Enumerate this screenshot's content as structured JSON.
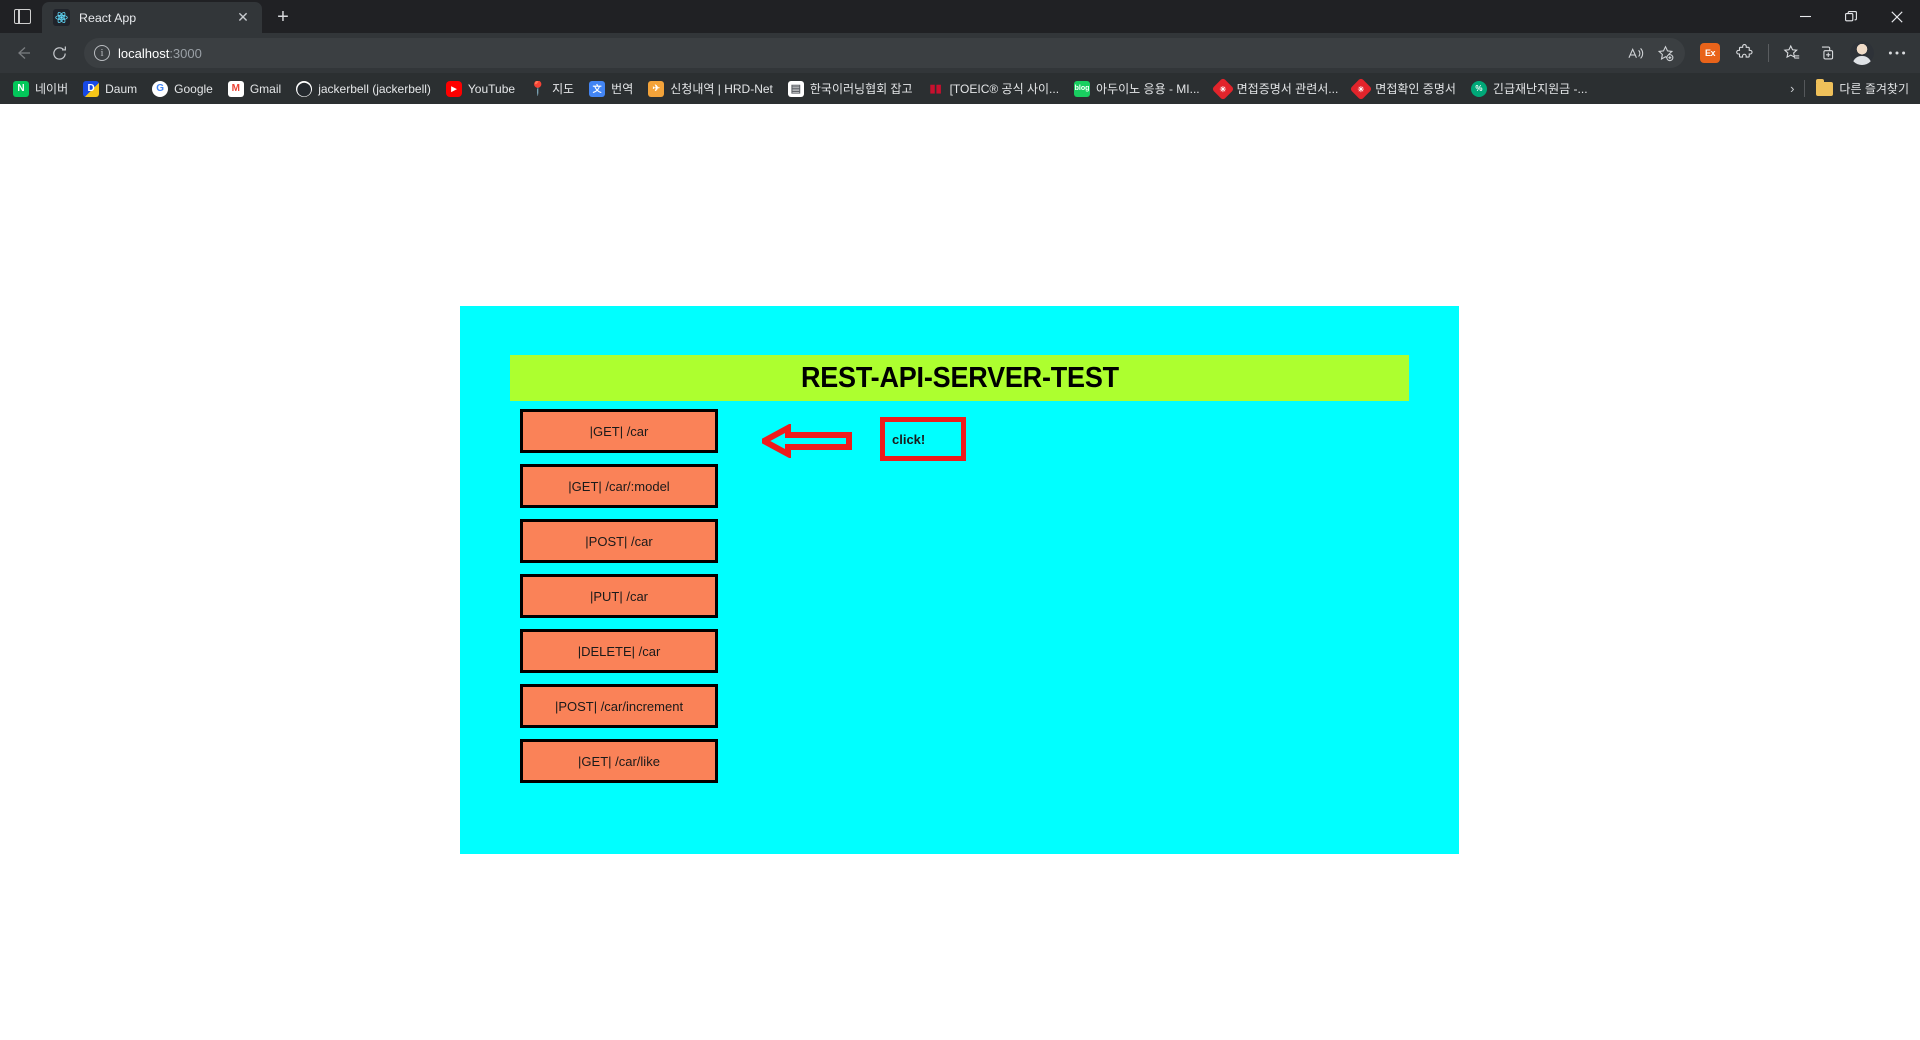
{
  "window": {
    "controls": [
      {
        "name": "minimize",
        "glyph": "—"
      },
      {
        "name": "restore",
        "glyph": "❐"
      },
      {
        "name": "close",
        "glyph": "✕"
      }
    ]
  },
  "tabstrip": {
    "tab_search_icon": "panel-icon",
    "tabs": [
      {
        "title": "React App",
        "favicon": "react-icon",
        "close_glyph": "✕"
      }
    ],
    "new_tab_glyph": "+"
  },
  "navbar": {
    "back_glyph": "←",
    "refresh_glyph": "⟳",
    "url_prefix": "localhost",
    "url_suffix": ":3000",
    "info_icon_glyph": "i",
    "read_aloud_glyph": "A",
    "add_favorite_glyph": "☆",
    "extension_badge_label": "Ex",
    "extensions_glyph": "puzzle",
    "collections_glyph": "star-list",
    "split_screen_glyph": "tab-plus",
    "settings_glyph": "…"
  },
  "bookmarks": {
    "items": [
      {
        "label": "네이버",
        "icon": "naver-icon",
        "color": "#03c75a",
        "text": "N"
      },
      {
        "label": "Daum",
        "icon": "daum-icon",
        "color": "#1749e6",
        "text": "D"
      },
      {
        "label": "Google",
        "icon": "google-icon",
        "color": "#ffffff",
        "text": "G"
      },
      {
        "label": "Gmail",
        "icon": "gmail-icon",
        "color": "#ffffff",
        "text": "M"
      },
      {
        "label": "jackerbell (jackerbell)",
        "icon": "github-icon",
        "color": "#ffffff",
        "text": "●"
      },
      {
        "label": "YouTube",
        "icon": "youtube-icon",
        "color": "#ff0000",
        "text": "▶"
      },
      {
        "label": "지도",
        "icon": "maps-icon",
        "color": "#34a853",
        "text": "◆"
      },
      {
        "label": "번역",
        "icon": "translate-icon",
        "color": "#4285f4",
        "text": "文"
      },
      {
        "label": "신청내역 | HRD-Net",
        "icon": "hrdnet-icon",
        "color": "#f3a33a",
        "text": "✈"
      },
      {
        "label": "한국이러닝협회 잡고",
        "icon": "document-icon",
        "color": "#ffffff",
        "text": "▤"
      },
      {
        "label": "[TOEIC® 공식 사이...",
        "icon": "toeic-icon",
        "color": "#c8102e",
        "text": "▮"
      },
      {
        "label": "아두이노 응용 - MI...",
        "icon": "blog-icon",
        "color": "#19ce60",
        "text": "b"
      },
      {
        "label": "면접증명서 관련서...",
        "icon": "certificate-icon",
        "color": "#e2242b",
        "text": "✳"
      },
      {
        "label": "면접확인 증명서",
        "icon": "certificate-icon",
        "color": "#e2242b",
        "text": "✳"
      },
      {
        "label": "긴급재난지원금 -...",
        "icon": "relief-icon",
        "color": "#00a878",
        "text": "%"
      }
    ],
    "overflow_glyph": "›",
    "other_favorites_label": "다른 즐겨찾기",
    "other_favorites_icon": "folder-icon"
  },
  "page": {
    "title": "REST-API-SERVER-TEST",
    "background_color": "#00ffff",
    "banner_color": "#adff2f",
    "button_color": "#fa8258",
    "annotation_color": "#ee1b1b",
    "buttons": [
      {
        "label": "|GET| /car"
      },
      {
        "label": "|GET| /car/:model"
      },
      {
        "label": "|POST| /car"
      },
      {
        "label": "|PUT| /car"
      },
      {
        "label": "|DELETE| /car"
      },
      {
        "label": "|POST| /car/increment"
      },
      {
        "label": "|GET| /car/like"
      }
    ],
    "annotation": {
      "arrow_direction": "left",
      "note_text": "click!"
    }
  }
}
